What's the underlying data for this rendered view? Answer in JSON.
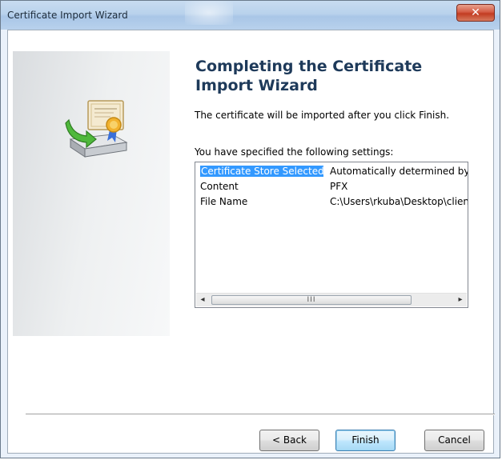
{
  "window": {
    "title": "Certificate Import Wizard",
    "close_glyph": "✕"
  },
  "wizard": {
    "heading": "Completing the Certificate Import Wizard",
    "description": "The certificate will be imported after you click Finish.",
    "settings_label": "You have specified the following settings:",
    "icon": "certificate-import-icon"
  },
  "settings": {
    "rows": [
      {
        "name": "Certificate Store Selected",
        "value": "Automatically determined by t",
        "selected": true
      },
      {
        "name": "Content",
        "value": "PFX",
        "selected": false
      },
      {
        "name": "File Name",
        "value": "C:\\Users\\rkuba\\Desktop\\client",
        "selected": false
      }
    ],
    "scroll_left": "◂",
    "scroll_right": "▸",
    "thumb_grip": "III"
  },
  "buttons": {
    "back": "< Back",
    "finish": "Finish",
    "cancel": "Cancel"
  },
  "colors": {
    "selection": "#3399ff",
    "heading": "#1e3a5a",
    "close": "#c23c21"
  }
}
